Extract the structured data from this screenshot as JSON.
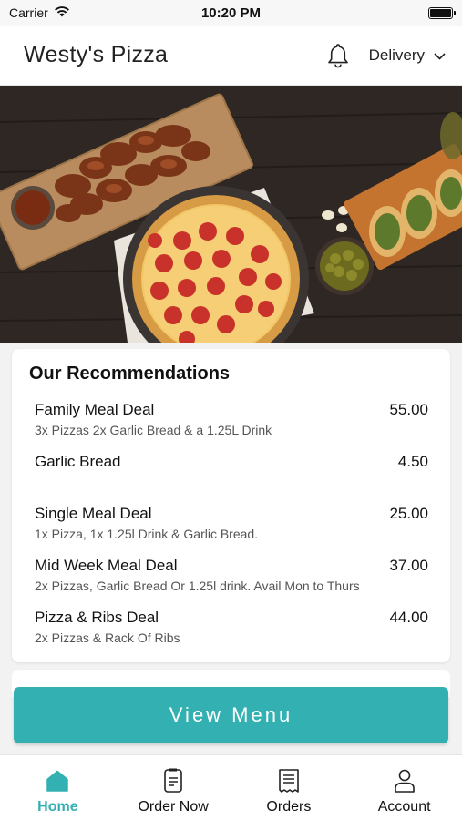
{
  "status_bar": {
    "carrier": "Carrier",
    "time": "10:20 PM"
  },
  "header": {
    "title": "Westy's Pizza",
    "delivery_label": "Delivery"
  },
  "hero": {
    "image_alt": "pizza-food-photo"
  },
  "recommendations": {
    "title": "Our Recommendations",
    "items": [
      {
        "name": "Family Meal Deal",
        "price": "55.00",
        "description": "3x Pizzas 2x Garlic Bread & a 1.25L Drink"
      },
      {
        "name": "Garlic Bread",
        "price": "4.50",
        "description": ""
      },
      {
        "name": "Single Meal Deal",
        "price": "25.00",
        "description": "1x Pizza, 1x 1.25l Drink & Garlic Bread."
      },
      {
        "name": "Mid Week Meal Deal",
        "price": "37.00",
        "description": "2x Pizzas, Garlic Bread Or 1.25l drink. Avail Mon to Thurs"
      },
      {
        "name": "Pizza & Ribs Deal",
        "price": "44.00",
        "description": "2x Pizzas & Rack Of Ribs"
      }
    ]
  },
  "view_menu_label": "View Menu",
  "tabs": [
    {
      "label": "Home",
      "icon": "home-icon",
      "active": true
    },
    {
      "label": "Order Now",
      "icon": "order-now-icon",
      "active": false
    },
    {
      "label": "Orders",
      "icon": "receipt-icon",
      "active": false
    },
    {
      "label": "Account",
      "icon": "account-icon",
      "active": false
    }
  ],
  "colors": {
    "accent": "#33b0b1",
    "background": "#f2f2f2"
  }
}
